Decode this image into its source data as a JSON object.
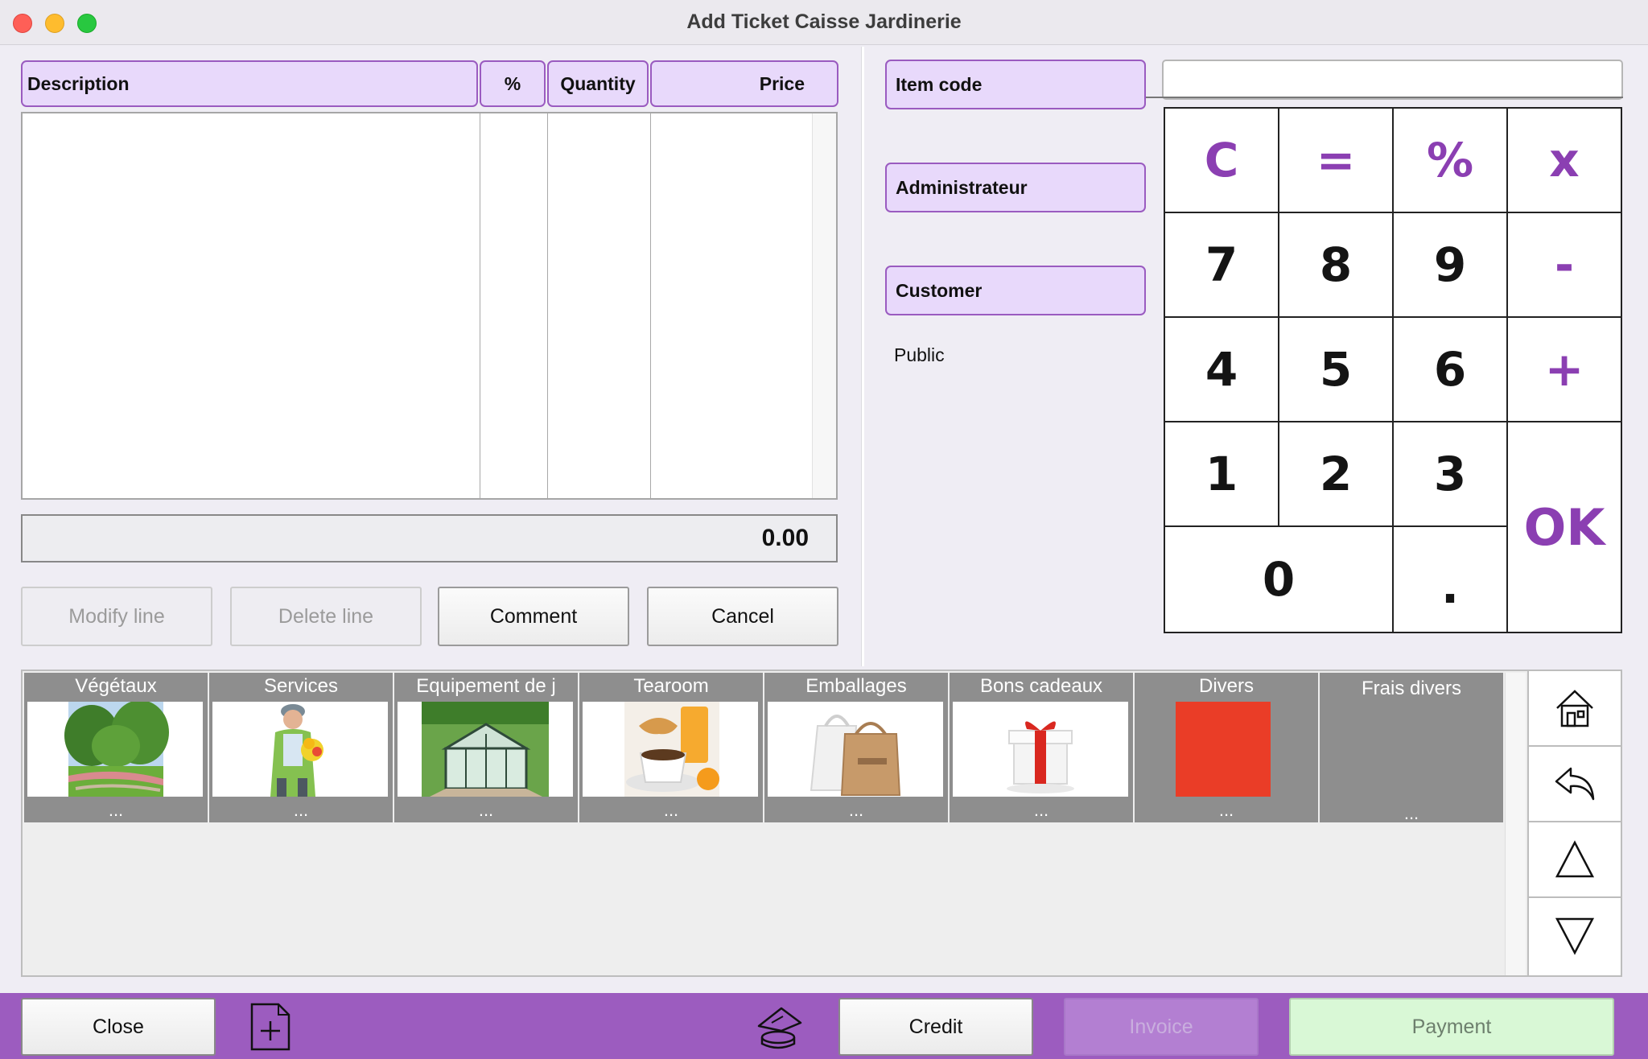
{
  "window": {
    "title": "Add Ticket Caisse Jardinerie"
  },
  "ticket": {
    "columns": {
      "description": "Description",
      "percent": "%",
      "quantity": "Quantity",
      "price": "Price"
    },
    "total": "0.00",
    "buttons": {
      "modify": "Modify line",
      "delete": "Delete line",
      "comment": "Comment",
      "cancel": "Cancel"
    }
  },
  "right_panel": {
    "item_code_label": "Item code",
    "item_code_value": "",
    "operator_label": "Administrateur",
    "customer_label": "Customer",
    "customer_value": "Public"
  },
  "keypad": {
    "row1": [
      "C",
      "=",
      "%",
      "x"
    ],
    "row2": [
      "7",
      "8",
      "9",
      "-"
    ],
    "row3": [
      "4",
      "5",
      "6",
      "+"
    ],
    "row4": [
      "1",
      "2",
      "3"
    ],
    "zero": "0",
    "dot": ".",
    "ok": "OK"
  },
  "categories": [
    {
      "name": "Végétaux",
      "icon": "park-garden-photo",
      "more": "..."
    },
    {
      "name": "Services",
      "icon": "gardener-photo",
      "more": "..."
    },
    {
      "name": "Equipement de j",
      "icon": "greenhouse-photo",
      "more": "..."
    },
    {
      "name": "Tearoom",
      "icon": "coffee-croissant-photo",
      "more": "..."
    },
    {
      "name": "Emballages",
      "icon": "paper-bags-photo",
      "more": "..."
    },
    {
      "name": "Bons cadeaux",
      "icon": "gift-box-photo",
      "more": "..."
    },
    {
      "name": "Divers",
      "icon": "red-square",
      "color": "#ea3d27",
      "more": "..."
    },
    {
      "name": "Frais divers",
      "icon": "none",
      "more": "..."
    }
  ],
  "nav_icons": [
    "home-icon",
    "undo-icon",
    "up-triangle-icon",
    "down-triangle-icon"
  ],
  "bottom_bar": {
    "close": "Close",
    "credit": "Credit",
    "invoice": "Invoice",
    "payment": "Payment",
    "icons": [
      "new-document-icon",
      "coins-hand-icon"
    ]
  },
  "colors": {
    "accent": "#9c5cbf",
    "header_fill": "#e8d9fb",
    "operator_purple": "#8b3fb2",
    "payment_fill": "#d9f8d6"
  }
}
